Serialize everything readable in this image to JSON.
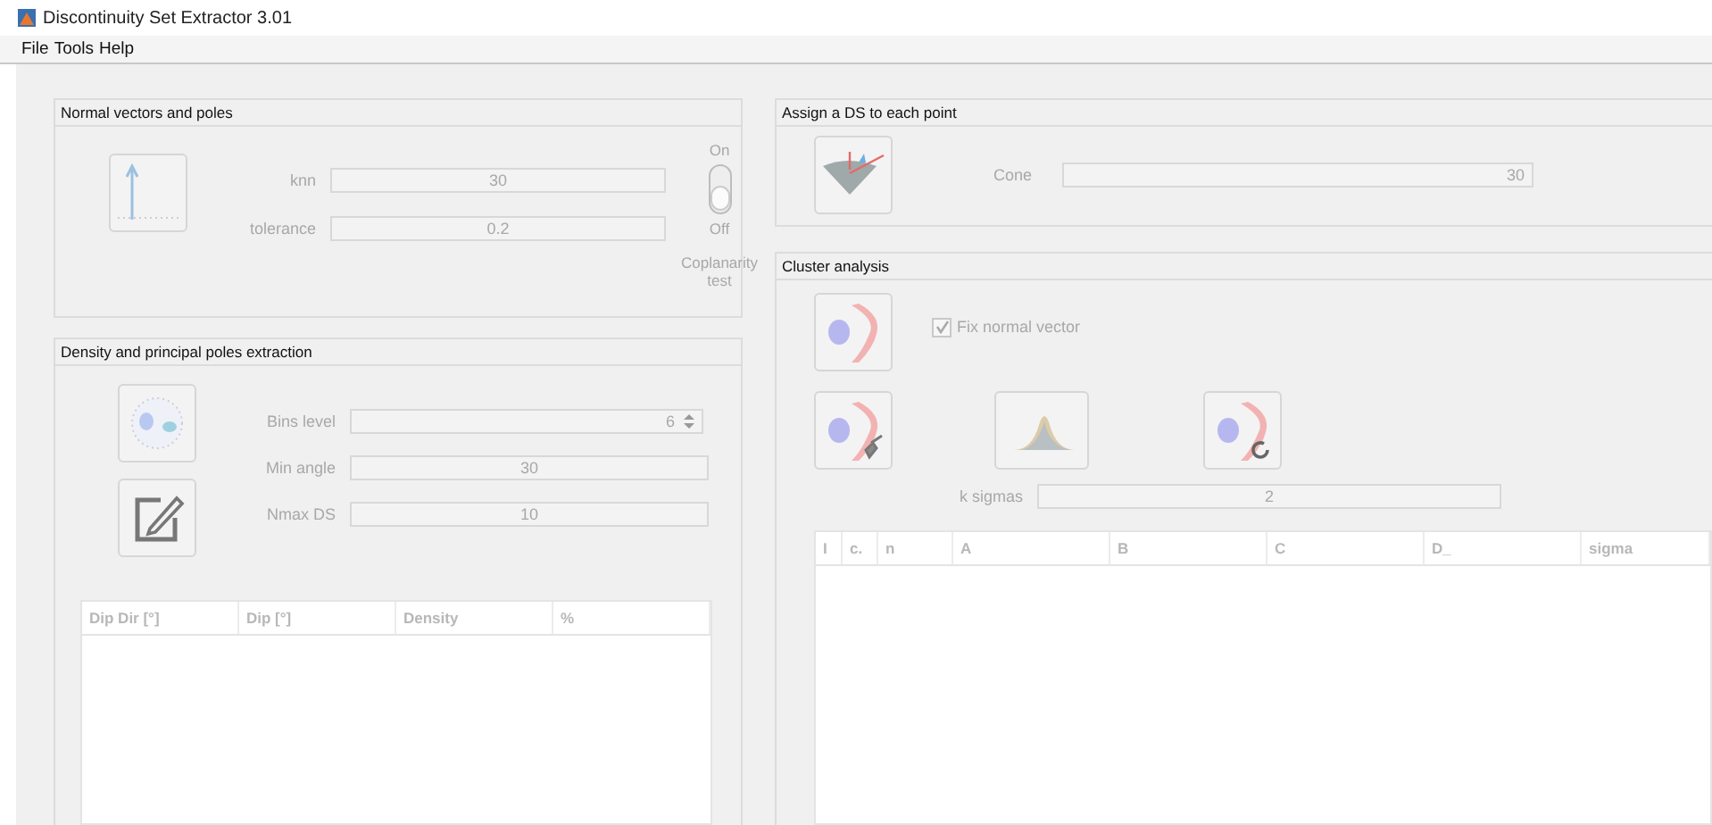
{
  "window": {
    "title": "Discontinuity Set Extractor 3.01"
  },
  "menu": [
    "File",
    "Tools",
    "Help"
  ],
  "disabled": true,
  "normal_vectors": {
    "title": "Normal vectors and poles",
    "fields": [
      {
        "label": "knn",
        "value": "30"
      },
      {
        "label": "tolerance",
        "value": "0.2"
      }
    ],
    "switch": {
      "on_label": "On",
      "off_label": "Off",
      "caption": "Coplanarity test",
      "on": false
    }
  },
  "density": {
    "title": "Density and principal poles extraction",
    "fields": [
      {
        "label": "Bins level",
        "value": "6",
        "kind": "spinner"
      },
      {
        "label": "Min angle",
        "value": "30",
        "kind": "text"
      },
      {
        "label": "Nmax DS",
        "value": "10",
        "kind": "text"
      }
    ],
    "table": {
      "columns": [
        "Dip Dir [°]",
        "Dip [°]",
        "Density",
        "%"
      ]
    }
  },
  "assign": {
    "title": "Assign a DS to each point",
    "field": {
      "label": "Cone",
      "value": "30"
    }
  },
  "cluster": {
    "title": "Cluster analysis",
    "checkbox": {
      "label": "Fix normal vector",
      "checked": true
    },
    "field": {
      "label": "k sigmas",
      "value": "2"
    },
    "table": {
      "columns": [
        "I",
        "c.",
        "n",
        "A",
        "B",
        "C",
        "D_",
        "sigma"
      ]
    }
  }
}
